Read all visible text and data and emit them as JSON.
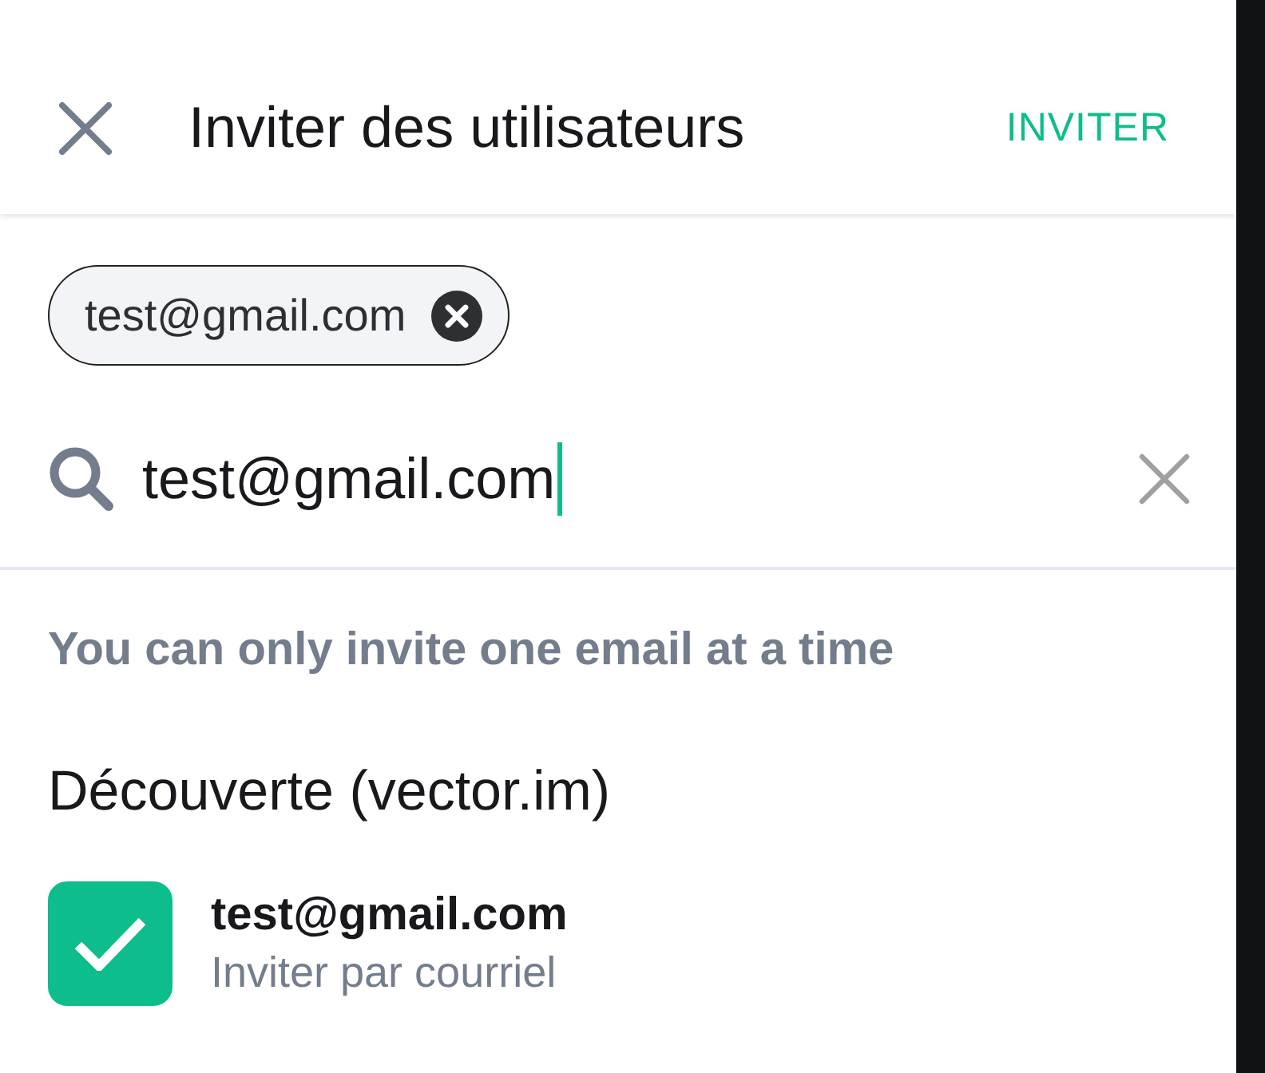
{
  "toolbar": {
    "title": "Inviter des utilisateurs",
    "action": "INVITER"
  },
  "chips": [
    {
      "label": "test@gmail.com"
    }
  ],
  "search": {
    "value": "test@gmail.com",
    "focused": true
  },
  "notice": "You can only invite one email at a time",
  "section": {
    "title": "Découverte (vector.im)",
    "items": [
      {
        "title": "test@gmail.com",
        "subtitle": "Inviter par courriel",
        "selected": true
      }
    ]
  }
}
